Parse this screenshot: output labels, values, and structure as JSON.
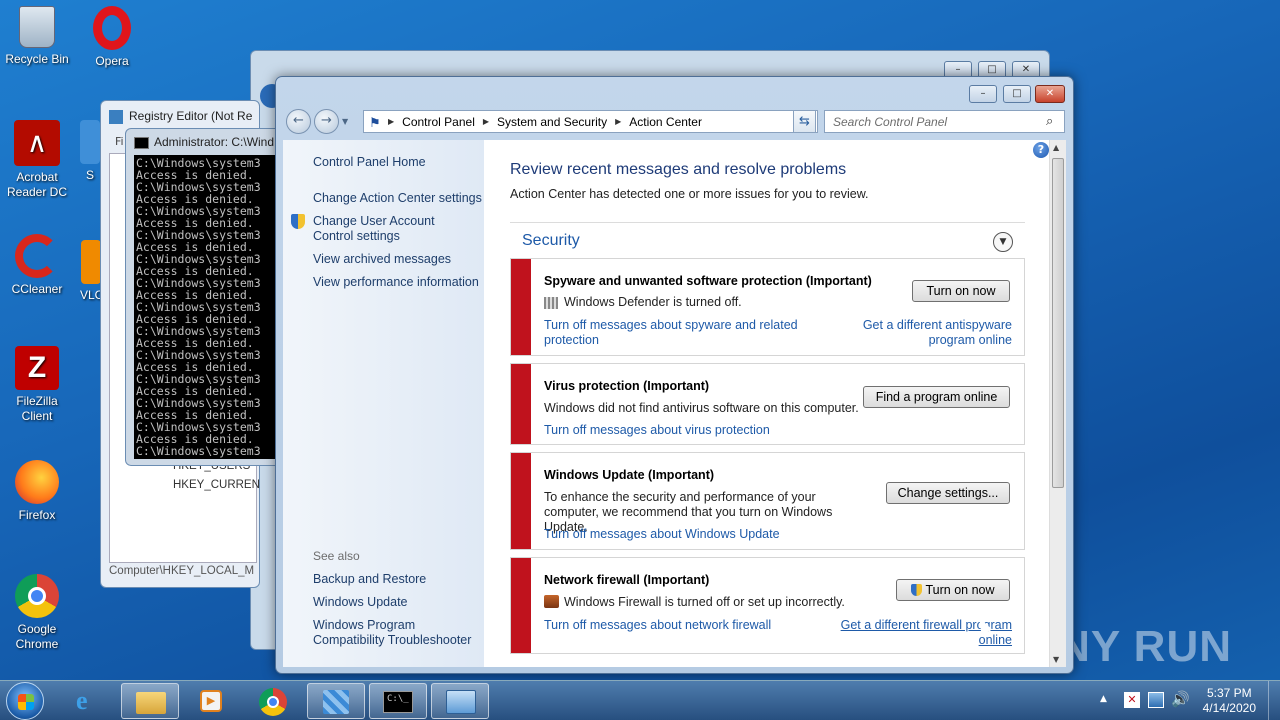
{
  "desktop": {
    "icons": [
      {
        "label": "Recycle Bin"
      },
      {
        "label": "Opera"
      },
      {
        "label": "Acrobat Reader DC"
      },
      {
        "label": "CCleaner"
      },
      {
        "label": "FileZilla Client"
      },
      {
        "label": "Firefox"
      },
      {
        "label": "Google Chrome"
      },
      {
        "label": "S"
      },
      {
        "label": "VLC"
      }
    ],
    "watermark": "ANY RUN"
  },
  "registry_window": {
    "title": "Registry Editor (Not Re",
    "tree_items": [
      "HKEY_USERS",
      "HKEY_CURREN"
    ],
    "status": "Computer\\HKEY_LOCAL_M",
    "menu_fragment": "Fi"
  },
  "cmd_window": {
    "title": "Administrator: C:\\Wind",
    "lines": [
      "C:\\Windows\\system3",
      "Access is denied.",
      "C:\\Windows\\system3",
      "Access is denied.",
      "C:\\Windows\\system3",
      "Access is denied.",
      "C:\\Windows\\system3",
      "Access is denied.",
      "C:\\Windows\\system3",
      "Access is denied.",
      "C:\\Windows\\system3",
      "Access is denied.",
      "C:\\Windows\\system3",
      "Access is denied.",
      "C:\\Windows\\system3",
      "Access is denied.",
      "C:\\Windows\\system3",
      "Access is denied.",
      "C:\\Windows\\system3",
      "Access is denied.",
      "C:\\Windows\\system3",
      "Access is denied.",
      "C:\\Windows\\system3",
      "Access is denied.",
      "C:\\Windows\\system3"
    ]
  },
  "action_center": {
    "breadcrumb": [
      "Control Panel",
      "System and Security",
      "Action Center"
    ],
    "search_placeholder": "Search Control Panel",
    "sidebar": {
      "home": "Control Panel Home",
      "links": [
        "Change Action Center settings",
        "Change User Account Control settings",
        "View archived messages",
        "View performance information"
      ],
      "see_also_heading": "See also",
      "see_also": [
        "Backup and Restore",
        "Windows Update",
        "Windows Program Compatibility Troubleshooter"
      ]
    },
    "header": {
      "title": "Review recent messages and resolve problems",
      "subtitle": "Action Center has detected one or more issues for you to review."
    },
    "section_title": "Security",
    "cards": [
      {
        "title": "Spyware and unwanted software protection  (Important)",
        "desc": "Windows Defender is turned off.",
        "button": "Turn on now",
        "link_left": "Turn off messages about spyware and related protection",
        "link_right": "Get a different antispyware program online"
      },
      {
        "title": "Virus protection  (Important)",
        "desc": "Windows did not find antivirus software on this computer.",
        "button": "Find a program online",
        "link_left": "Turn off messages about virus protection"
      },
      {
        "title": "Windows Update  (Important)",
        "desc": "To enhance the security and performance of your computer, we recommend that you turn on Windows Update.",
        "button": "Change settings...",
        "link_left": "Turn off messages about Windows Update"
      },
      {
        "title": "Network firewall  (Important)",
        "desc": "Windows Firewall is turned off or set up incorrectly.",
        "button": "Turn on now",
        "link_left": "Turn off messages about network firewall",
        "link_right": "Get a different firewall program online"
      }
    ]
  },
  "taskbar": {
    "time": "5:37 PM",
    "date": "4/14/2020"
  }
}
